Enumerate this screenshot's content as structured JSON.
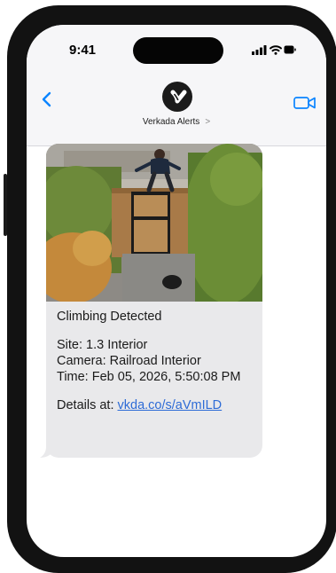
{
  "status_bar": {
    "time": "9:41"
  },
  "header": {
    "contact_name": "Verkada Alerts",
    "contact_chevron": ">"
  },
  "message": {
    "title": "Climbing Detected",
    "site": "Site: 1.3 Interior",
    "camera": "Camera: Railroad Interior",
    "time": "Time: Feb 05, 2026, 5:50:08 PM",
    "details_prefix": "Details at: ",
    "details_link": "vkda.co/s/aVmILD"
  },
  "colors": {
    "bubble": "#e9e9eb",
    "link": "#2d6bd6",
    "ios_blue": "#0a84ff"
  },
  "icons": [
    "back-chevron-icon",
    "video-call-icon",
    "verkada-logo-icon",
    "cellular-signal-icon",
    "wifi-icon",
    "battery-icon"
  ]
}
